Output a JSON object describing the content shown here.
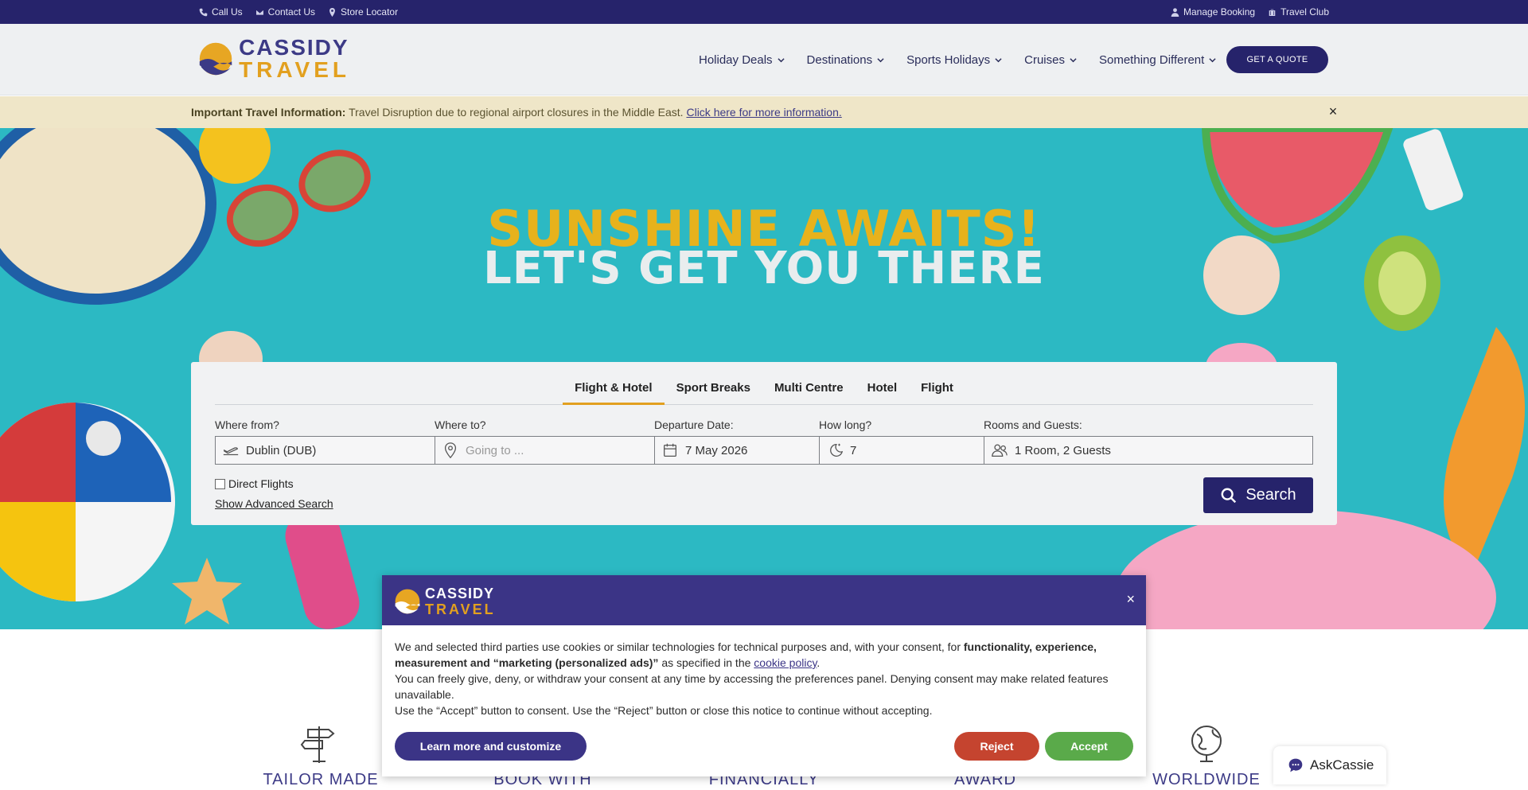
{
  "topbar": {
    "call_us": "Call Us",
    "contact_us": "Contact Us",
    "store_locator": "Store Locator",
    "manage_booking": "Manage Booking",
    "travel_club": "Travel Club"
  },
  "header": {
    "logo_line1": "CASSIDY",
    "logo_line2": "TRAVEL",
    "nav": [
      "Holiday Deals",
      "Destinations",
      "Sports Holidays",
      "Cruises",
      "Something Different"
    ],
    "quote_button": "GET A QUOTE"
  },
  "info_banner": {
    "label": "Important Travel Information:",
    "message": " Travel Disruption due to regional airport closures in the Middle East. ",
    "link": "Click here for more information.",
    "close": "×"
  },
  "hero": {
    "line1": "SUNSHINE AWAITS!",
    "line2": "LET'S GET YOU THERE"
  },
  "search": {
    "tabs": [
      "Flight & Hotel",
      "Sport Breaks",
      "Multi Centre",
      "Hotel",
      "Flight"
    ],
    "active_tab": "Flight & Hotel",
    "from_label": "Where from?",
    "from_value": "Dublin (DUB)",
    "to_label": "Where to?",
    "to_placeholder": "Going to ...",
    "date_label": "Departure Date:",
    "date_value": "7 May 2026",
    "duration_label": "How long?",
    "duration_value": "7",
    "guests_label": "Rooms and Guests:",
    "guests_value": "1 Room, 2 Guests",
    "direct_flights": "Direct Flights",
    "advanced": "Show Advanced Search",
    "search_button": "Search"
  },
  "features": [
    "TAILOR MADE",
    "BOOK WITH",
    "FINANCIALLY",
    "AWARD WINNING",
    "WORLDWIDE"
  ],
  "cookie": {
    "logo_line1": "CASSIDY",
    "logo_line2": "TRAVEL",
    "close": "×",
    "p1_start": "We and selected third parties use cookies or similar technologies for technical purposes and, with your consent, for ",
    "p1_bold": "functionality, experience, measurement and “marketing (personalized ads)”",
    "p1_mid": " as specified in the ",
    "p1_link": "cookie policy",
    "p1_end": ".",
    "p2": "You can freely give, deny, or withdraw your consent at any time by accessing the preferences panel. Denying consent may make related features unavailable.",
    "p3": "Use the “Accept” button to consent. Use the “Reject” button or close this notice to continue without accepting.",
    "learn_button": "Learn more and customize",
    "reject_button": "Reject",
    "accept_button": "Accept"
  },
  "chat": {
    "label": "AskCassie"
  },
  "colors": {
    "navy": "#26236b",
    "purple": "#3b3486",
    "gold": "#e2a01f",
    "teal": "#2cb9c3",
    "reject": "#c5442f",
    "accept": "#5aaa4a"
  }
}
